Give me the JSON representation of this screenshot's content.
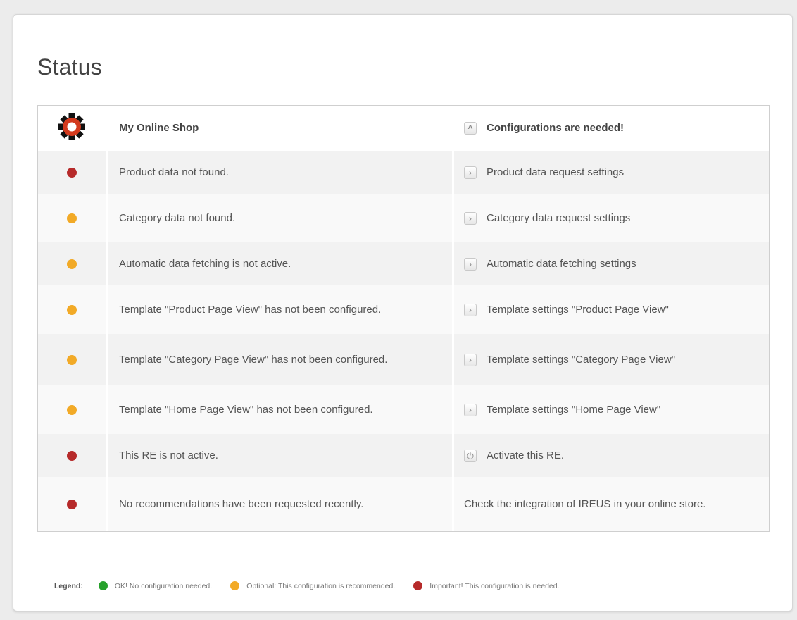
{
  "page": {
    "title": "Status"
  },
  "header": {
    "icon": "gear-icon",
    "shop_name": "My Online Shop",
    "action_icon": "chevron-up-icon",
    "status_message": "Configurations are needed!"
  },
  "colors": {
    "important": "#b62a2a",
    "optional": "#f2aa27",
    "ok": "#27a12c"
  },
  "rows": [
    {
      "severity": "important",
      "message": "Product data not found.",
      "action_icon": "chevron-right-icon",
      "action": "Product data request settings"
    },
    {
      "severity": "optional",
      "message": "Category data not found.",
      "action_icon": "chevron-right-icon",
      "action": "Category data request settings"
    },
    {
      "severity": "optional",
      "message": "Automatic data fetching is not active.",
      "action_icon": "chevron-right-icon",
      "action": "Automatic data fetching settings"
    },
    {
      "severity": "optional",
      "message": "Template \"Product Page View\" has not been configured.",
      "action_icon": "chevron-right-icon",
      "action": "Template settings \"Product Page View\""
    },
    {
      "severity": "optional",
      "message": "Template \"Category Page View\" has not been configured.",
      "action_icon": "chevron-right-icon",
      "action": "Template settings \"Category Page View\""
    },
    {
      "severity": "optional",
      "message": "Template \"Home Page View\" has not been configured.",
      "action_icon": "chevron-right-icon",
      "action": "Template settings \"Home Page View\""
    },
    {
      "severity": "important",
      "message": "This RE is not active.",
      "action_icon": "power-icon",
      "action": "Activate this RE."
    },
    {
      "severity": "important",
      "message": "No recommendations have been requested recently.",
      "action": "Check the integration of IREUS in your online store."
    }
  ],
  "legend": {
    "label": "Legend:",
    "items": [
      {
        "severity": "ok",
        "text": "OK! No configuration needed."
      },
      {
        "severity": "optional",
        "text": "Optional: This configuration is recommended."
      },
      {
        "severity": "important",
        "text": "Important! This configuration is needed."
      }
    ]
  }
}
